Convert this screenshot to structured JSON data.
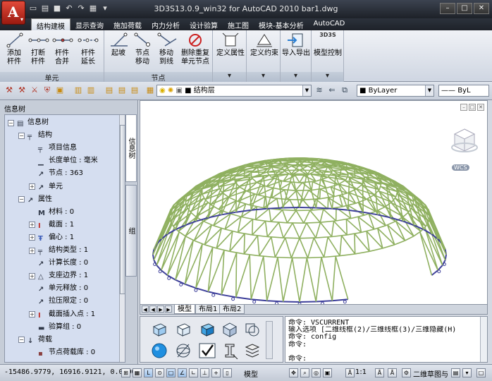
{
  "window": {
    "title": "3D3S13.0.9_win32 for AutoCAD 2010   bar1.dwg",
    "app_letter": "A"
  },
  "ribbon": {
    "tabs": [
      "结构建模",
      "显示查询",
      "施加荷载",
      "内力分析",
      "设计验算",
      "施工图",
      "模块-基本分析",
      "AutoCAD"
    ],
    "groups": {
      "unit_label": "单元",
      "node_label": "节点"
    },
    "unit_buttons": [
      {
        "line1": "添加",
        "line2": "杆件"
      },
      {
        "line1": "打断",
        "line2": "杆件"
      },
      {
        "line1": "杆件",
        "line2": "合并"
      },
      {
        "line1": "杆件",
        "line2": "延长"
      }
    ],
    "node_buttons": [
      {
        "line1": "起坡",
        "line2": ""
      },
      {
        "line1": "节点",
        "line2": "移动"
      },
      {
        "line1": "移动",
        "line2": "到线"
      },
      {
        "line1": "删除重复",
        "line2": "单元节点"
      }
    ],
    "other_buttons": [
      {
        "label": "定义属性"
      },
      {
        "label": "定义约束"
      },
      {
        "label": "导入导出"
      },
      {
        "label": "模型控制",
        "badge": "3D3S"
      }
    ]
  },
  "toolbar": {
    "layer_combo": "结构层",
    "linetype_combo": "ByLayer",
    "lineweight_combo": "ByL"
  },
  "info_panel": {
    "title": "信息树",
    "side_tabs": [
      "信息树",
      "组"
    ],
    "tree": [
      {
        "label": "信息树",
        "level": 0,
        "expander": "−",
        "icon": "document-icon"
      },
      {
        "label": "结构",
        "level": 1,
        "expander": "−",
        "icon": "structure-icon"
      },
      {
        "label": "项目信息",
        "level": 2,
        "expander": "",
        "icon": "structure-icon"
      },
      {
        "label": "长度单位 : 毫米",
        "level": 2,
        "expander": "",
        "icon": "ruler-icon"
      },
      {
        "label": "节点 : 363",
        "level": 2,
        "expander": "",
        "icon": "node-icon"
      },
      {
        "label": "单元",
        "level": 2,
        "expander": "+",
        "icon": "element-icon"
      },
      {
        "label": "属性",
        "level": 1,
        "expander": "−",
        "icon": "property-icon"
      },
      {
        "label": "材料 : 0",
        "level": 2,
        "expander": "",
        "icon": "material-icon"
      },
      {
        "label": "截面 : 1",
        "level": 2,
        "expander": "+",
        "icon": "section-icon"
      },
      {
        "label": "偏心 : 1",
        "level": 2,
        "expander": "+",
        "icon": "eccentric-icon"
      },
      {
        "label": "结构类型 : 1",
        "level": 2,
        "expander": "+",
        "icon": "structure-icon"
      },
      {
        "label": "计算长度 : 0",
        "level": 2,
        "expander": "",
        "icon": "length-icon"
      },
      {
        "label": "支座边界 : 1",
        "level": 2,
        "expander": "+",
        "icon": "support-icon"
      },
      {
        "label": "单元释放 : 0",
        "level": 2,
        "expander": "",
        "icon": "release-icon"
      },
      {
        "label": "拉压限定 : 0",
        "level": 2,
        "expander": "",
        "icon": "tension-icon"
      },
      {
        "label": "截面插入点 : 1",
        "level": 2,
        "expander": "+",
        "icon": "section-icon"
      },
      {
        "label": "验算组 : 0",
        "level": 2,
        "expander": "",
        "icon": "check-icon"
      },
      {
        "label": "荷载",
        "level": 1,
        "expander": "−",
        "icon": "load-icon"
      },
      {
        "label": "节点荷载库 : 0",
        "level": 2,
        "expander": "",
        "icon": "node-load-icon"
      }
    ]
  },
  "viewport": {
    "wcs_label": "WCS",
    "layout_tabs": [
      "模型",
      "布局1",
      "布局2"
    ]
  },
  "command": {
    "lines": [
      "命令: VSCURRENT",
      "输入选项 [二维线框(2)/三维线框(3)/三维隐藏(H)",
      "命令: config",
      "命令:",
      "",
      "命令:"
    ]
  },
  "statusbar": {
    "coords": "-15486.9779, 16916.9121, 0.0000",
    "model_label": "模型",
    "scale_label": "1:1",
    "workspace_label": "二维草图与"
  },
  "colors": {
    "frame": "#2c323c",
    "grid_member": "#8fb060",
    "support": "#3d3f9a"
  }
}
